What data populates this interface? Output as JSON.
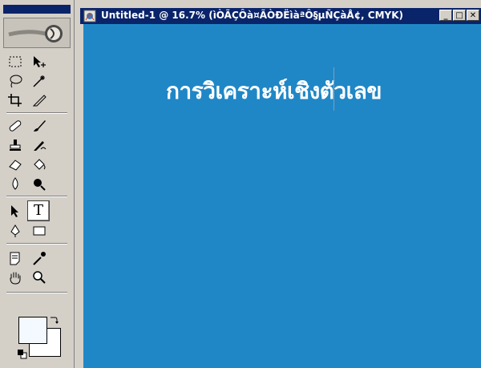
{
  "document": {
    "title": "Untitled-1 @ 16.7% (ìÒÃÇÔà¤ÃÒÐËìàªÔ§µÑÇàÅ¢, CMYK)",
    "canvas_text": "การวิเคราะห์เชิงตัวเลข",
    "canvas_color": "#1f87c6",
    "buttons": {
      "minimize": "_",
      "maximize": "□",
      "close": "✕"
    }
  },
  "toolbox": {
    "active_tool": "type-tool",
    "text_tool_glyph": "T",
    "foreground_color": "#f4f8ff",
    "background_color": "#ffffff",
    "tools": [
      "marquee-tool",
      "move-tool",
      "lasso-tool",
      "magic-wand-tool",
      "crop-tool",
      "slice-tool",
      "healing-brush-tool",
      "brush-tool",
      "clone-stamp-tool",
      "history-brush-tool",
      "eraser-tool",
      "paint-bucket-tool",
      "blur-tool",
      "burn-tool",
      "path-selection-tool",
      "type-tool",
      "pen-tool",
      "rectangle-tool",
      "notes-tool",
      "eyedropper-tool",
      "hand-tool",
      "zoom-tool"
    ]
  }
}
